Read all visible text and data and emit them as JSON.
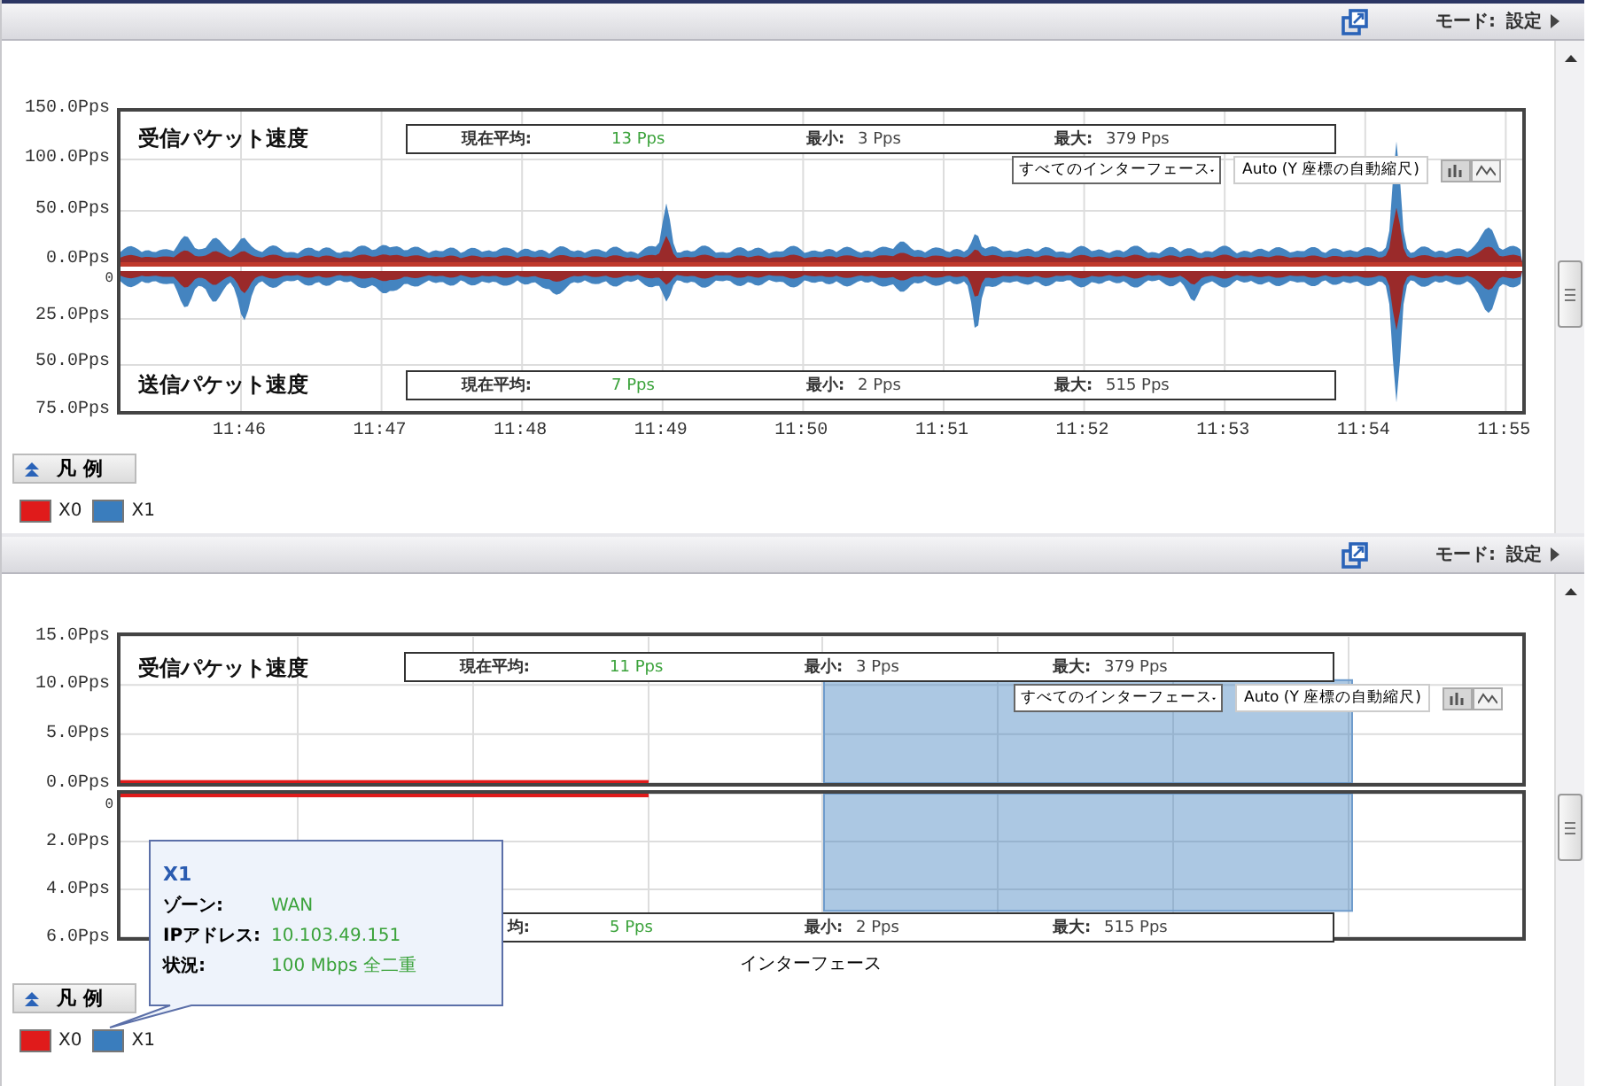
{
  "panels": [
    {
      "kind": "waveform",
      "toolbar": {
        "mode_label": "モード:",
        "mode_value": "設定"
      },
      "receive_axis": [
        "150.0Pps",
        "100.0Pps",
        "50.0Pps",
        "0.0Pps"
      ],
      "send_axis": [
        "0",
        "25.0Pps",
        "50.0Pps",
        "75.0Pps"
      ],
      "receive": {
        "title": "受信パケット速度",
        "avg_label": "現在平均:",
        "avg": "13 Pps",
        "min_label": "最小:",
        "min": "3 Pps",
        "max_label": "最大:",
        "max": "379 Pps"
      },
      "send": {
        "title": "送信パケット速度",
        "avg_label": "現在平均:",
        "avg": "7 Pps",
        "min_label": "最小:",
        "min": "2 Pps",
        "max_label": "最大:",
        "max": "515 Pps"
      },
      "interface_select": "すべてのインターフェース",
      "scale_button": "Auto (Y 座標の自動縮尺)",
      "time_labels": [
        "11:46",
        "11:47",
        "11:48",
        "11:49",
        "11:50",
        "11:51",
        "11:52",
        "11:53",
        "11:54",
        "11:55"
      ],
      "legend_button": "凡 例",
      "legend": [
        {
          "name": "X0",
          "color": "#e01b1b"
        },
        {
          "name": "X1",
          "color": "#3a7dbd"
        }
      ]
    },
    {
      "kind": "bars",
      "toolbar": {
        "mode_label": "モード:",
        "mode_value": "設定"
      },
      "receive": {
        "avg_label": "現在平均:",
        "avg": "11 Pps",
        "min_label": "最小:",
        "min": "3 Pps",
        "max_label": "最大:",
        "max": "379 Pps"
      },
      "send": {
        "avg_label": "均:",
        "avg": "5 Pps",
        "min_label": "最小:",
        "min": "2 Pps",
        "max_label": "最大:",
        "max": "515 Pps"
      },
      "interface_select": "すべてのインターフェース",
      "scale_button": "Auto (Y 座標の自動縮尺)",
      "receive_chart": {
        "chart_data": {
          "type": "bar",
          "title": "受信パケット速度",
          "grid": true,
          "ylim": [
            0,
            15
          ],
          "yticks": [
            {
              "value": 15,
              "label": "15.0Pps"
            },
            {
              "value": 10,
              "label": "10.0Pps"
            },
            {
              "value": 5,
              "label": "5.0Pps"
            },
            {
              "value": 0,
              "label": "0.0Pps"
            }
          ],
          "values": [
            0.3,
            10.5
          ]
        }
      },
      "send_chart": {
        "chart_data": {
          "type": "bar",
          "xlabel": "インターフェース",
          "grid": true,
          "ylim": [
            6,
            0
          ],
          "yticks": [
            {
              "value": 0,
              "label": "0"
            },
            {
              "value": 2,
              "label": "2.0Pps"
            },
            {
              "value": 4,
              "label": "4.0Pps"
            },
            {
              "value": 6,
              "label": "6.0Pps"
            }
          ],
          "values": [
            0.15,
            4.9
          ]
        }
      },
      "tooltip": {
        "title": "X1",
        "rows": [
          {
            "label": "ゾーン:",
            "value": "WAN"
          },
          {
            "label": "IPアドレス:",
            "value": "10.103.49.151"
          },
          {
            "label": "状況:",
            "value": "100 Mbps 全二重"
          }
        ]
      },
      "legend_button": "凡 例",
      "legend": [
        {
          "name": "X0",
          "color": "#e01b1b"
        },
        {
          "name": "X1",
          "color": "#3a7dbd"
        }
      ]
    }
  ]
}
